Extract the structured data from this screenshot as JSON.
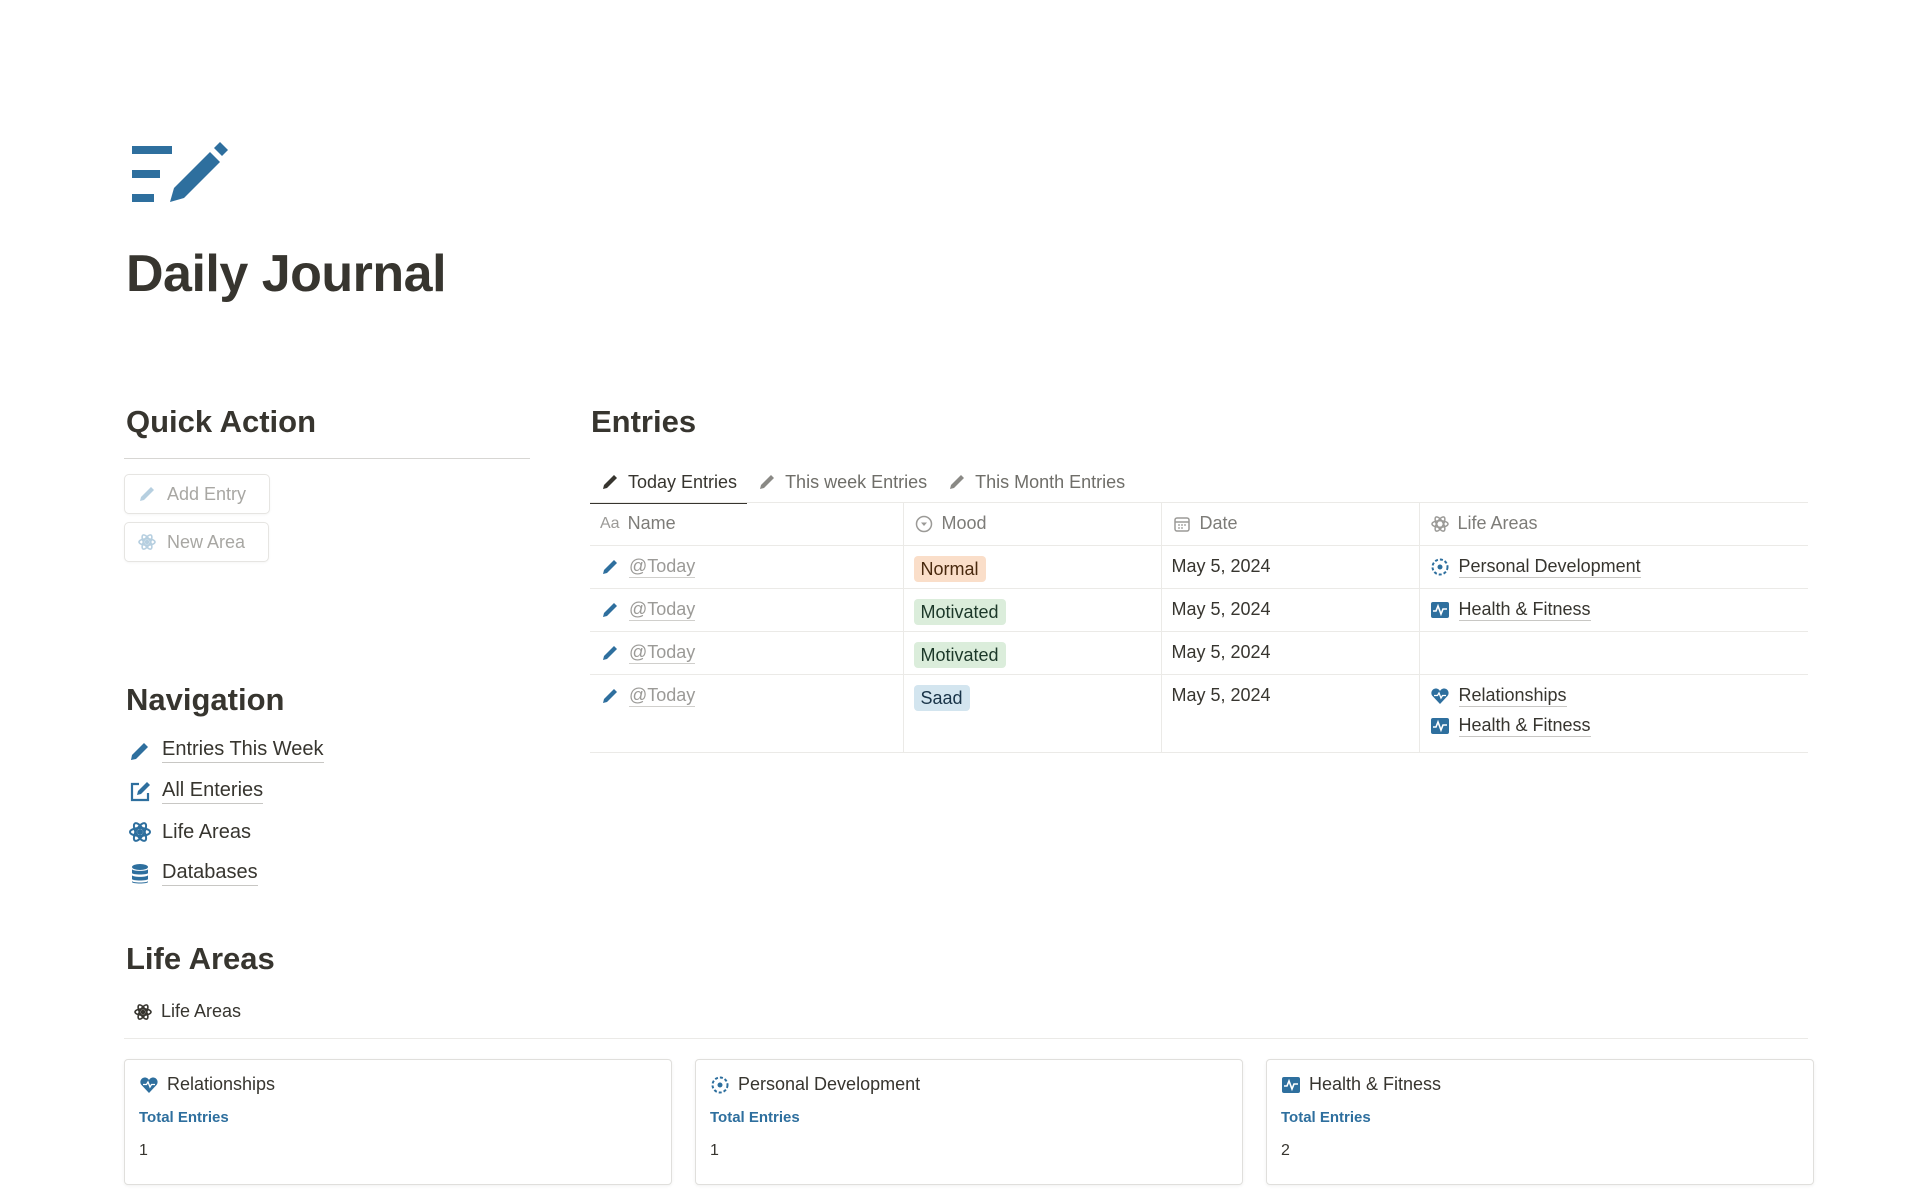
{
  "page": {
    "title": "Daily Journal",
    "icon": "note-pencil-icon"
  },
  "colors": {
    "accent": "#2e6f9e",
    "tag_normal_bg": "#fadec9",
    "tag_motivated_bg": "#dbeddb",
    "tag_saad_bg": "#d3e5ef"
  },
  "quick_action": {
    "title": "Quick Action",
    "buttons": [
      {
        "label": "Add Entry",
        "icon": "pencil-icon"
      },
      {
        "label": "New Area",
        "icon": "atom-icon"
      }
    ]
  },
  "navigation": {
    "title": "Navigation",
    "items": [
      {
        "label": "Entries This Week",
        "icon": "pencil-icon"
      },
      {
        "label": "All Enteries",
        "icon": "edit-square-icon"
      },
      {
        "label": "Life Areas",
        "icon": "atom-icon"
      },
      {
        "label": "Databases",
        "icon": "database-icon"
      }
    ]
  },
  "entries": {
    "title": "Entries",
    "tabs": [
      {
        "label": "Today Entries",
        "active": true
      },
      {
        "label": "This week Entries",
        "active": false
      },
      {
        "label": "This Month Entries",
        "active": false
      }
    ],
    "columns": {
      "name": "Name",
      "mood": "Mood",
      "date": "Date",
      "areas": "Life Areas"
    },
    "name_prefix_icon": "Aa",
    "rows": [
      {
        "name": "@Today",
        "mood": "Normal",
        "date": "May 5, 2024",
        "areas": [
          "Personal Development"
        ]
      },
      {
        "name": "@Today",
        "mood": "Motivated",
        "date": "May 5, 2024",
        "areas": [
          "Health & Fitness"
        ]
      },
      {
        "name": "@Today",
        "mood": "Motivated",
        "date": "May 5, 2024",
        "areas": []
      },
      {
        "name": "@Today",
        "mood": "Saad",
        "date": "May 5, 2024",
        "areas": [
          "Relationships",
          "Health & Fitness"
        ]
      }
    ]
  },
  "life_areas": {
    "title": "Life Areas",
    "view_label": "Life Areas",
    "property_label": "Total Entries",
    "cards": [
      {
        "name": "Relationships",
        "icon": "heart-pulse-icon",
        "total": "1"
      },
      {
        "name": "Personal Development",
        "icon": "cog-circle-icon",
        "total": "1"
      },
      {
        "name": "Health & Fitness",
        "icon": "activity-icon",
        "total": "2"
      }
    ]
  }
}
